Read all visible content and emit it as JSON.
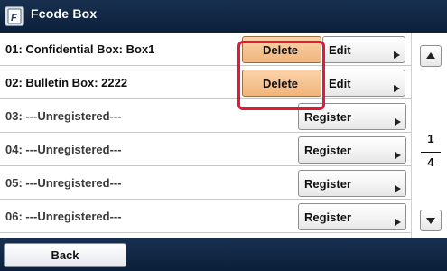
{
  "header": {
    "title": "Fcode Box",
    "icon": "fcode-box-icon"
  },
  "rows": [
    {
      "label": "01: Confidential Box: Box1",
      "buttons": [
        "Delete",
        "Edit"
      ]
    },
    {
      "label": "02: Bulletin Box: 2222",
      "buttons": [
        "Delete",
        "Edit"
      ]
    },
    {
      "label": "03: ---Unregistered---",
      "buttons": [
        "Register"
      ]
    },
    {
      "label": "04: ---Unregistered---",
      "buttons": [
        "Register"
      ]
    },
    {
      "label": "05: ---Unregistered---",
      "buttons": [
        "Register"
      ]
    },
    {
      "label": "06: ---Unregistered---",
      "buttons": [
        "Register"
      ]
    }
  ],
  "pagination": {
    "current": "1",
    "total": "4"
  },
  "footer": {
    "back_label": "Back"
  },
  "colors": {
    "bar": "#0b1f3a",
    "delete_button": "#f0b47d",
    "highlight_border": "#e21a3a"
  }
}
